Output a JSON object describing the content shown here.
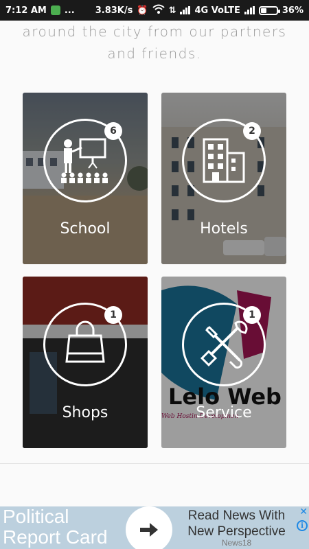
{
  "status_bar": {
    "time": "7:12 AM",
    "dots": "...",
    "speed": "3.83K/s",
    "network": "4G VoLTE",
    "battery": "36%",
    "battery_level": 0.36
  },
  "intro": {
    "line1": "around the city from our partners",
    "line2": "and friends."
  },
  "categories": [
    {
      "label": "School",
      "count": "6",
      "icon": "teacher-classroom-icon"
    },
    {
      "label": "Hotels",
      "count": "2",
      "icon": "building-icon"
    },
    {
      "label": "Shops",
      "count": "1",
      "icon": "shopping-bag-icon"
    },
    {
      "label": "Service",
      "count": "1",
      "icon": "tools-icon"
    }
  ],
  "service_bg_text": {
    "brand": "Lelo Web",
    "sub": "Web Hostin        Developmen"
  },
  "ad": {
    "headline": "Political Report Card",
    "headline_line1": "Political",
    "headline_line2": "Report Card",
    "tagline": "Read News With New Perspective",
    "source": "News18"
  },
  "colors": {
    "info_blue": "#1e88e5",
    "ad_bg": "#bcd0de"
  }
}
